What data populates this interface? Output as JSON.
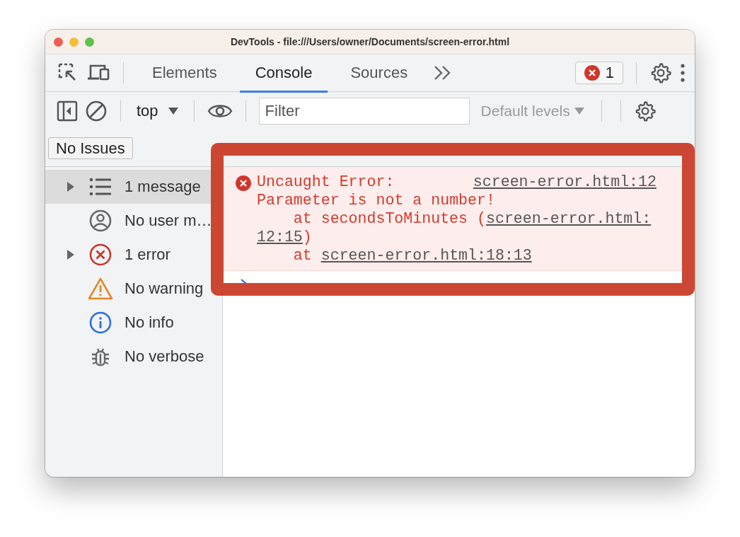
{
  "window": {
    "title": "DevTools - file:///Users/owner/Documents/screen-error.html"
  },
  "tabs": [
    {
      "label": "Elements",
      "selected": false
    },
    {
      "label": "Console",
      "selected": true
    },
    {
      "label": "Sources",
      "selected": false
    }
  ],
  "error_badge": {
    "count": "1"
  },
  "console_toolbar": {
    "context": "top",
    "filter": {
      "placeholder": "Filter"
    },
    "levels": {
      "label": "Default levels",
      "disabled": true
    }
  },
  "issues_button": "No Issues",
  "sidebar": {
    "items": [
      {
        "label": "1 message",
        "kind": "messages",
        "expandable": true,
        "selected": true
      },
      {
        "label": "No user m…",
        "kind": "user",
        "expandable": false,
        "selected": false
      },
      {
        "label": "1 error",
        "kind": "error",
        "expandable": true,
        "selected": false
      },
      {
        "label": "No warning",
        "kind": "warning",
        "expandable": false,
        "selected": false
      },
      {
        "label": "No info",
        "kind": "info",
        "expandable": false,
        "selected": false
      },
      {
        "label": "No verbose",
        "kind": "verbose",
        "expandable": false,
        "selected": false
      }
    ]
  },
  "console": {
    "messages": [
      {
        "kind": "error",
        "title": "Uncaught Error:",
        "source": "screen-error.html:12",
        "text": "Parameter is not a number!",
        "stack": [
          {
            "text": "at secondsToMinutes (",
            "link": "screen-error.html:",
            "link_continued": "12:15",
            "after": ")"
          },
          {
            "text": "at ",
            "link": "screen-error.html:18:13"
          }
        ]
      }
    ]
  },
  "highlight": {
    "shown": true
  }
}
